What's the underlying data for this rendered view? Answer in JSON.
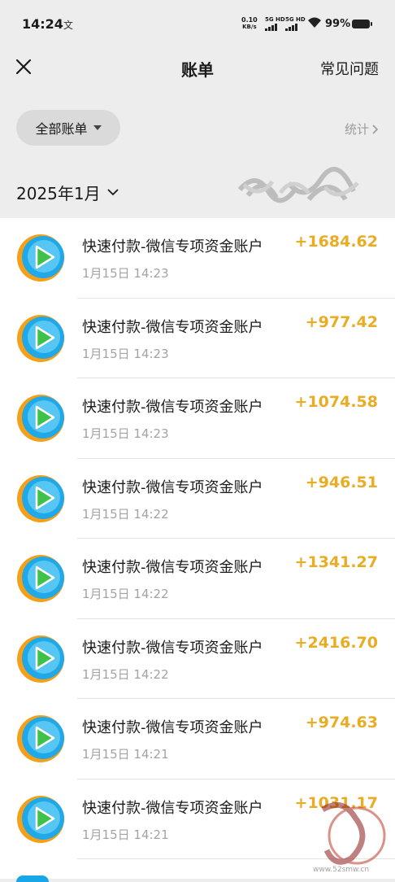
{
  "status_bar": {
    "time": "14:24",
    "notification_glyph": "文",
    "net_speed_value": "0.10",
    "net_speed_unit": "KB/s",
    "sim1_label": "5G HD",
    "sim2_label": "5G HD",
    "battery": "99%"
  },
  "nav": {
    "close_icon": "close-icon",
    "title": "账单",
    "faq": "常见问题"
  },
  "filter": {
    "label": "全部账单"
  },
  "stats": {
    "label": "统计"
  },
  "month": {
    "label": "2025年1月"
  },
  "colors": {
    "amount": "#e9ac22",
    "secondary_text": "#a3a3a3",
    "page_bg": "#ededed"
  },
  "transactions": [
    {
      "title": "快速付款-微信专项资金账户",
      "time": "1月15日 14:23",
      "amount": "+1684.62"
    },
    {
      "title": "快速付款-微信专项资金账户",
      "time": "1月15日 14:23",
      "amount": "+977.42"
    },
    {
      "title": "快速付款-微信专项资金账户",
      "time": "1月15日 14:23",
      "amount": "+1074.58"
    },
    {
      "title": "快速付款-微信专项资金账户",
      "time": "1月15日 14:22",
      "amount": "+946.51"
    },
    {
      "title": "快速付款-微信专项资金账户",
      "time": "1月15日 14:22",
      "amount": "+1341.27"
    },
    {
      "title": "快速付款-微信专项资金账户",
      "time": "1月15日 14:22",
      "amount": "+2416.70"
    },
    {
      "title": "快速付款-微信专项资金账户",
      "time": "1月15日 14:21",
      "amount": "+974.63"
    },
    {
      "title": "快速付款-微信专项资金账户",
      "time": "1月15日 14:21",
      "amount": "+1031.17"
    }
  ],
  "watermark": {
    "text": "吾爱首码",
    "url": "www.52smw.cn"
  }
}
